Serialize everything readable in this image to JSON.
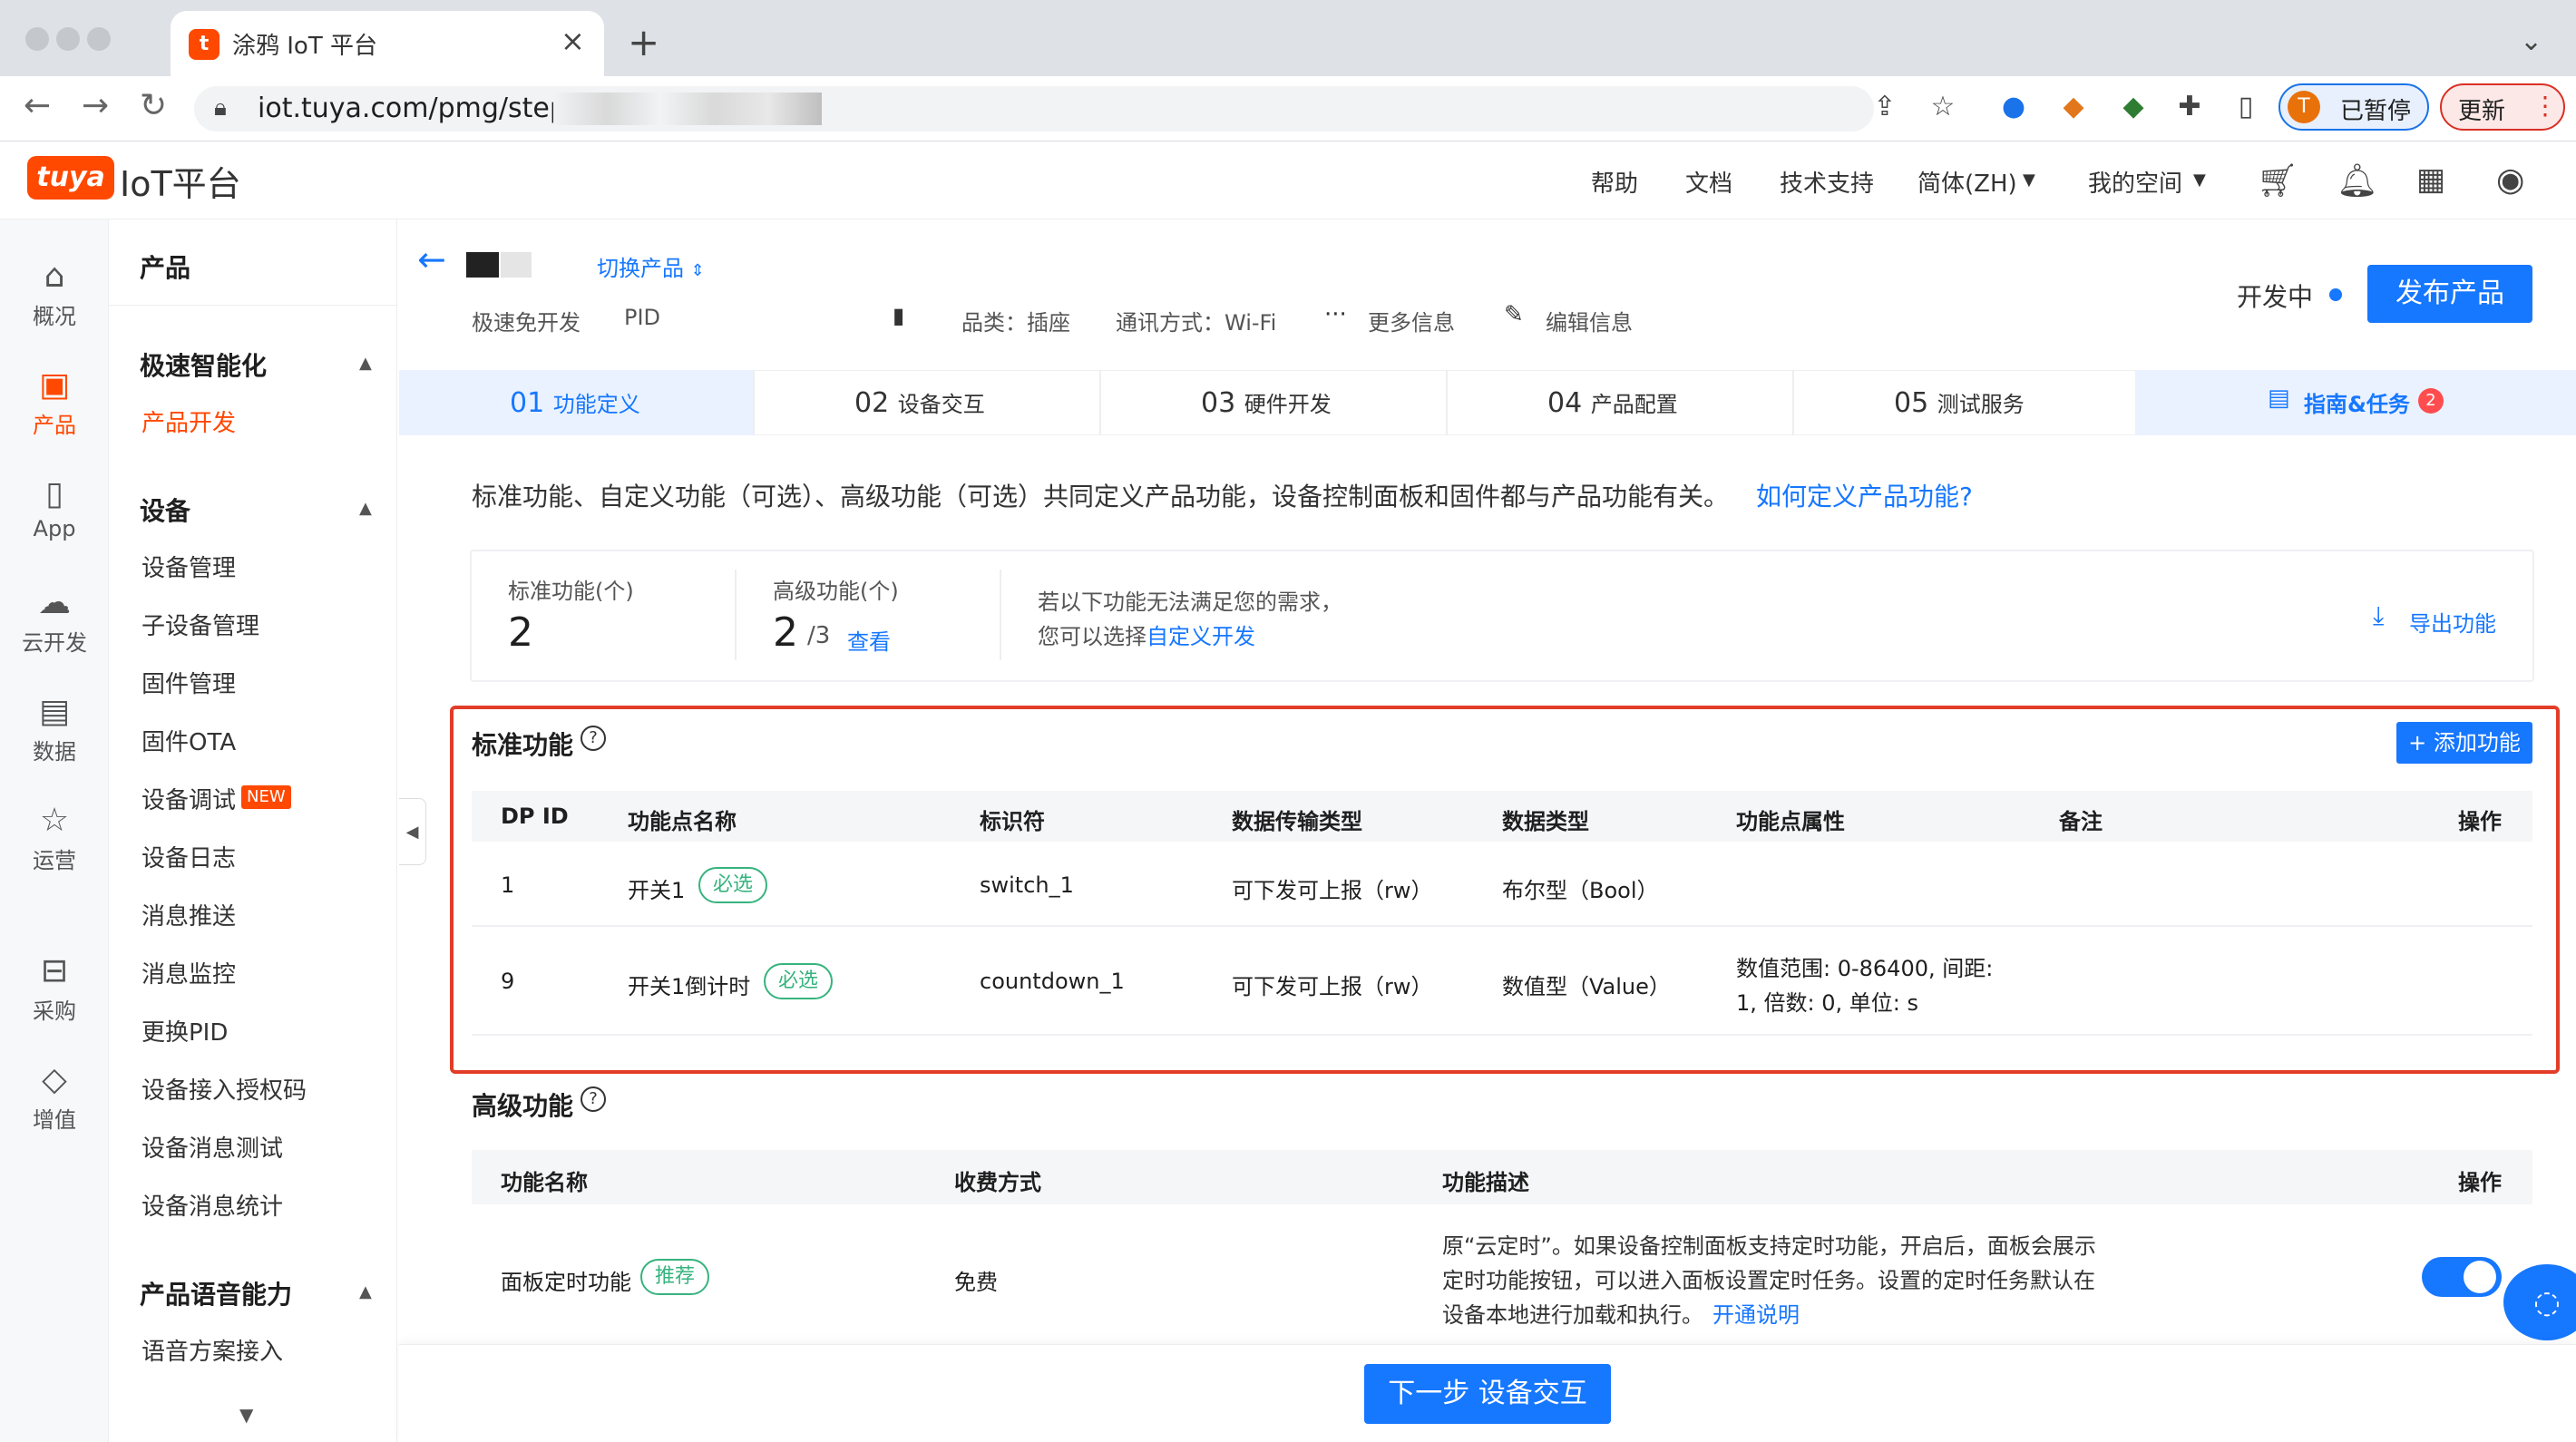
{
  "browser": {
    "tab_title": "涂鸦 IoT 平台",
    "url": "iot.tuya.com/pmg/step?id",
    "profile_initial": "T",
    "profile_label": "已暂停",
    "update_label": "更新"
  },
  "header": {
    "logo": "tuya",
    "title": "IoT平台",
    "nav": [
      "帮助",
      "文档",
      "技术支持",
      "简体(ZH)",
      "我的空间"
    ]
  },
  "rail": [
    {
      "label": "概况",
      "icon": "home-icon"
    },
    {
      "label": "产品",
      "icon": "terminal-icon"
    },
    {
      "label": "App",
      "icon": "phone-icon"
    },
    {
      "label": "云开发",
      "icon": "cloud-icon"
    },
    {
      "label": "数据",
      "icon": "chart-icon"
    },
    {
      "label": "运营",
      "icon": "star-badge-icon"
    },
    {
      "label": "采购",
      "icon": "store-icon"
    },
    {
      "label": "增值",
      "icon": "diamond-icon"
    }
  ],
  "sidemenu": {
    "title": "产品",
    "sections": [
      {
        "title": "极速智能化",
        "items": [
          "产品开发"
        ]
      },
      {
        "title": "设备",
        "items": [
          "设备管理",
          "子设备管理",
          "固件管理",
          "固件OTA",
          "设备调试",
          "设备日志",
          "消息推送",
          "消息监控",
          "更换PID",
          "设备接入授权码",
          "设备消息测试",
          "设备消息统计"
        ]
      },
      {
        "title": "产品语音能力",
        "items": [
          "语音方案接入"
        ]
      }
    ],
    "new_badge": "NEW"
  },
  "product": {
    "switch_label": "切换产品",
    "dev_mode": "极速免开发",
    "pid_label": "PID",
    "category": "品类：插座",
    "protocol": "通讯方式：Wi-Fi",
    "more_info": "更多信息",
    "edit_info": "编辑信息",
    "status": "开发中",
    "publish_label": "发布产品"
  },
  "steps": [
    {
      "num": "01",
      "label": "功能定义"
    },
    {
      "num": "02",
      "label": "设备交互"
    },
    {
      "num": "03",
      "label": "硬件开发"
    },
    {
      "num": "04",
      "label": "产品配置"
    },
    {
      "num": "05",
      "label": "测试服务"
    }
  ],
  "guide": {
    "label": "指南&任务",
    "count": "2"
  },
  "intro": {
    "text": "标准功能、自定义功能（可选）、高级功能（可选）共同定义产品功能，设备控制面板和固件都与产品功能有关。",
    "link": "如何定义产品功能?"
  },
  "stats": {
    "std_label": "标准功能(个)",
    "std_value": "2",
    "adv_label": "高级功能(个)",
    "adv_value": "2",
    "adv_total": "/3",
    "adv_view": "查看",
    "hint_line1": "若以下功能无法满足您的需求，",
    "hint_line2_prefix": "您可以选择",
    "hint_link": "自定义开发",
    "export_label": "导出功能"
  },
  "standard": {
    "title": "标准功能",
    "add_label": "+ 添加功能",
    "columns": [
      "DP ID",
      "功能点名称",
      "标识符",
      "数据传输类型",
      "数据类型",
      "功能点属性",
      "备注",
      "操作"
    ],
    "rows": [
      {
        "dp": "1",
        "name": "开关1",
        "tag": "必选",
        "id": "switch_1",
        "transfer": "可下发可上报（rw）",
        "type": "布尔型（Bool）",
        "attr1": "",
        "attr2": ""
      },
      {
        "dp": "9",
        "name": "开关1倒计时",
        "tag": "必选",
        "id": "countdown_1",
        "transfer": "可下发可上报（rw）",
        "type": "数值型（Value）",
        "attr1": "数值范围: 0-86400, 间距:",
        "attr2": "1, 倍数: 0, 单位: s"
      }
    ]
  },
  "advanced": {
    "title": "高级功能",
    "columns": [
      "功能名称",
      "收费方式",
      "功能描述",
      "操作"
    ],
    "row": {
      "name": "面板定时功能",
      "tag": "推荐",
      "fee": "免费",
      "desc1": "原“云定时”。如果设备控制面板支持定时功能，开启后，面板会展示",
      "desc2": "定时功能按钮，可以进入面板设置定时任务。设置的定时任务默认在",
      "desc3": "设备本地进行加载和执行。",
      "desc_link": "开通说明",
      "enabled": true
    }
  },
  "footer": {
    "next_label": "下一步 设备交互"
  }
}
